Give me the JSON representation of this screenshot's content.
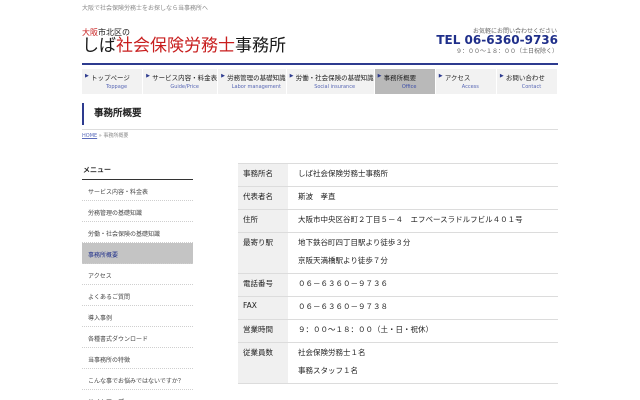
{
  "header": {
    "tagline": "大阪で社会保険労務士をお探しなら当事務所へ",
    "logo_small_red": "大阪",
    "logo_small_rest": "市北区の",
    "logo_main_black1": "しば",
    "logo_main_red": "社会保険労務士",
    "logo_main_black2": "事務所",
    "contact_note": "お気軽にお問い合わせください",
    "tel": "TEL 06-6360-9736",
    "hours": "９：００〜１８：００（土日祝除く）"
  },
  "nav": [
    {
      "label": "トップページ",
      "en": "Toppage",
      "active": false
    },
    {
      "label": "サービス内容・料金表",
      "en": "Guide/Price",
      "active": false
    },
    {
      "label": "労務管理の基礎知識",
      "en": "Labor management",
      "active": false
    },
    {
      "label": "労働・社会保険の基礎知識",
      "en": "Social insurance",
      "active": false
    },
    {
      "label": "事務所概要",
      "en": "Office",
      "active": true
    },
    {
      "label": "アクセス",
      "en": "Access",
      "active": false
    },
    {
      "label": "お問い合わせ",
      "en": "Contact",
      "active": false
    }
  ],
  "page": {
    "title": "事務所概要",
    "breadcrumb_home": "HOME",
    "breadcrumb_sep": "»",
    "breadcrumb_current": "事務所概要"
  },
  "sidebar": {
    "title": "メニュー",
    "items": [
      {
        "label": "サービス内容・料金表",
        "active": false
      },
      {
        "label": "労務管理の基礎知識",
        "active": false
      },
      {
        "label": "労働・社会保険の基礎知識",
        "active": false
      },
      {
        "label": "事務所概要",
        "active": true
      },
      {
        "label": "アクセス",
        "active": false
      },
      {
        "label": "よくあるご質問",
        "active": false
      },
      {
        "label": "導入事例",
        "active": false
      },
      {
        "label": "各種書式ダウンロード",
        "active": false
      },
      {
        "label": "当事務所の特徴",
        "active": false
      },
      {
        "label": "こんな事でお悩みではないですか？",
        "active": false
      },
      {
        "label": "サイトマップ",
        "active": false
      }
    ]
  },
  "office_table": [
    {
      "label": "事務所名",
      "lines": [
        "しば社会保険労務士事務所"
      ]
    },
    {
      "label": "代表者名",
      "lines": [
        "斯波　孝直"
      ]
    },
    {
      "label": "住所",
      "lines": [
        "大阪市中央区谷町２丁目５－４　エフベースラドルフビル４０１号"
      ]
    },
    {
      "label": "最寄り駅",
      "lines": [
        "地下鉄谷町四丁目駅より徒歩３分",
        "京阪天満橋駅より徒歩７分"
      ]
    },
    {
      "label": "電話番号",
      "lines": [
        "０６－６３６０－９７３６"
      ]
    },
    {
      "label": "FAX",
      "lines": [
        "０６－６３６０－９７３８"
      ]
    },
    {
      "label": "営業時間",
      "lines": [
        "９：００～１８：００（土・日・祝休）"
      ]
    },
    {
      "label": "従業員数",
      "lines": [
        "社会保険労務士１名",
        "事務スタッフ１名"
      ]
    }
  ]
}
